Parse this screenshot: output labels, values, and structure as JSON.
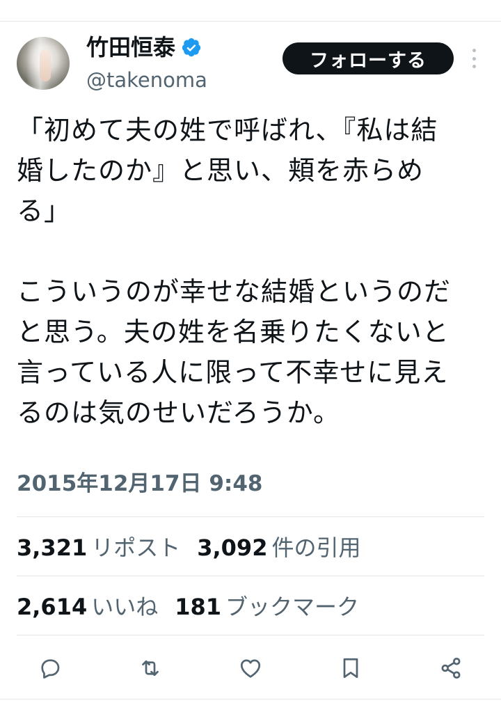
{
  "author": {
    "display_name": "竹田恒泰",
    "handle": "@takenoma",
    "verified_color": "#1d9bf0"
  },
  "follow_button": {
    "label": "フォローする"
  },
  "tweet": {
    "lines_block1": [
      "「初めて夫の姓で呼ばれ、『私は結",
      "婚したのか』と思い、頬を赤らめ",
      "る」"
    ],
    "lines_block2": [
      "こういうのが幸せな結婚というのだ",
      "と思う。夫の姓を名乗りたくないと",
      "言っている人に限って不幸せに見え",
      "るのは気のせいだろうか。"
    ]
  },
  "timestamp": "2015年12月17日 9:48",
  "stats": {
    "reposts_count": "3,321",
    "reposts_label": "リポスト",
    "quotes_count": "3,092",
    "quotes_label": "件の引用",
    "likes_count": "2,614",
    "likes_label": "いいね",
    "bookmarks_count": "181",
    "bookmarks_label": "ブックマーク"
  },
  "actions": [
    "reply-icon",
    "repost-icon",
    "like-icon",
    "bookmark-icon",
    "share-icon"
  ],
  "colors": {
    "text": "#0f1419",
    "secondary": "#536471",
    "icon": "#536471"
  }
}
